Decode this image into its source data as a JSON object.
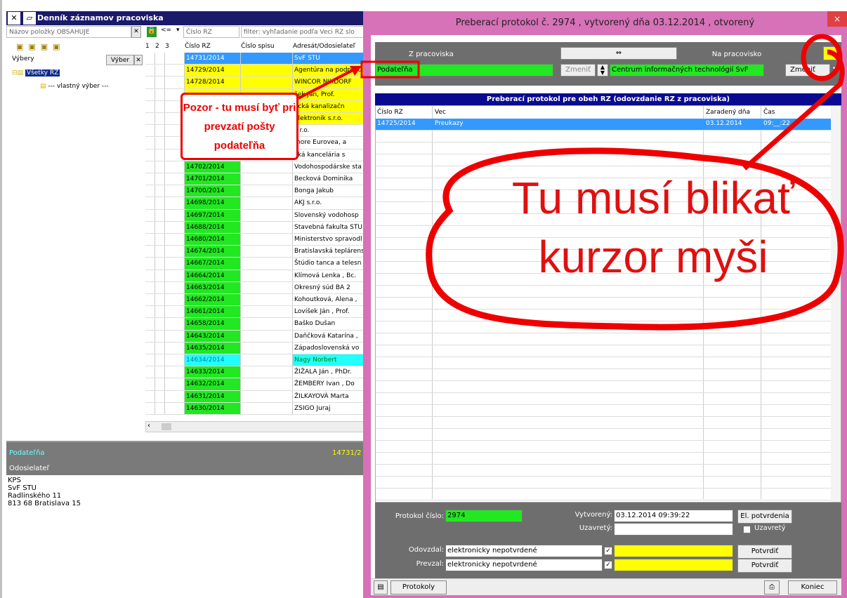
{
  "main": {
    "title": "Denník záznamov pracoviska",
    "filter_label": "Názov položky OBSAHUJE",
    "nav_arrow": "<=",
    "nav_dropdown_value": "Číslo RZ",
    "filter_hint": "filter: vyhľadanie podľa Veci RZ slo",
    "tree_selector_label": "Výbery",
    "tree_selector_button": "Výber",
    "tree_items": [
      "Všetky RZ",
      "--- vlastný výber ---"
    ],
    "grid_headers": [
      "1",
      "2",
      "3",
      "Číslo RZ",
      "Číslo spisu",
      "Adresát/Odosielateľ"
    ],
    "rows": [
      {
        "rz": "14731/2014",
        "who": "SvF STU",
        "style": "selected"
      },
      {
        "rz": "14729/2014",
        "who": "Agentúra na podporu",
        "style": "yellow"
      },
      {
        "rz": "14728/2014",
        "who": "WINCOR NIXDORF",
        "style": "yellow"
      },
      {
        "rz": "",
        "who": "šek Ján, Prof.",
        "style": "yellow"
      },
      {
        "rz": "",
        "who": "ecká kanalizačn",
        "style": "yellow"
      },
      {
        "rz": "",
        "who": "Elektronik s.r.o.",
        "style": "yellow"
      },
      {
        "rz": "",
        "who": "s r.o.",
        "style": "none"
      },
      {
        "rz": "",
        "who": "more Eurovea, a",
        "style": "none"
      },
      {
        "rz": "",
        "who": "cká kancelária s",
        "style": "none"
      },
      {
        "rz": "14702/2014",
        "who": "Vodohospodárske sta",
        "style": "green"
      },
      {
        "rz": "14701/2014",
        "who": "Becková Dominika",
        "style": "green"
      },
      {
        "rz": "14700/2014",
        "who": "Bonga Jakub",
        "style": "green"
      },
      {
        "rz": "14698/2014",
        "who": "AKJ s.r.o.",
        "style": "green"
      },
      {
        "rz": "14697/2014",
        "who": "Slovenský vodohosp",
        "style": "green"
      },
      {
        "rz": "14688/2014",
        "who": "Stavebná fakulta STU",
        "style": "green"
      },
      {
        "rz": "14680/2014",
        "who": "Ministerstvo spravodl",
        "style": "green"
      },
      {
        "rz": "14674/2014",
        "who": "Bratislavská teplárens",
        "style": "green"
      },
      {
        "rz": "14667/2014",
        "who": "Štúdio tanca a telesn",
        "style": "green"
      },
      {
        "rz": "14664/2014",
        "who": "Klímová Lenka , Bc.",
        "style": "green"
      },
      {
        "rz": "14663/2014",
        "who": "Okresný súd BA 2",
        "style": "green"
      },
      {
        "rz": "14662/2014",
        "who": "Kohoutková, Alena ,",
        "style": "green"
      },
      {
        "rz": "14661/2014",
        "who": "Lovíšek Ján , Prof.",
        "style": "green"
      },
      {
        "rz": "14658/2014",
        "who": "Baško Dušan",
        "style": "green"
      },
      {
        "rz": "14643/2014",
        "who": "Daňčková Katarína ,",
        "style": "green"
      },
      {
        "rz": "14635/2014",
        "who": "Západoslovenská vo",
        "style": "green"
      },
      {
        "rz": "14634/2014",
        "who": "Nagy Norbert",
        "style": "cyan"
      },
      {
        "rz": "14633/2014",
        "who": "ŽIŽALA Ján , PhDr.",
        "style": "green"
      },
      {
        "rz": "14632/2014",
        "who": "ŽEMBERY Ivan , Do",
        "style": "green"
      },
      {
        "rz": "14631/2014",
        "who": "ŽILKAYOVÁ Marta",
        "style": "green"
      },
      {
        "rz": "14630/2014",
        "who": "ZSIGO Juraj",
        "style": "green"
      }
    ],
    "bottom": {
      "podatelna": "Podateľňa",
      "rz": "14731/2",
      "odosielatel_label": "Odosielateľ",
      "address": [
        "KPS",
        "SvF STU",
        "Radlinského 11",
        "813 68  Bratislava 15"
      ]
    }
  },
  "dialog": {
    "title": "Preberací protokol č. 2974 , vytvorený dňa 03.12.2014 , otvorený",
    "close": "×",
    "from_label": "Z pracoviska",
    "swap_symbol": "⇔",
    "to_label": "Na pracovisko",
    "from_value": "Podateľňa",
    "change_label": "Zmeniť",
    "to_value": "Centrum informačných technológií SvF",
    "change_label2": "Zmeniť",
    "section_title": "Preberací protokol pre obeh RZ (odovzdanie RZ z pracoviska)",
    "table_headers": [
      "Číslo RZ",
      "Vec",
      "Zaradený dňa",
      "Čas"
    ],
    "table_rows": [
      {
        "rz": "14725/2014",
        "vec": "Preukazy",
        "datum": "03.12.2014",
        "cas": "09:__:22"
      }
    ],
    "protokol_label": "Protokol číslo:",
    "protokol_value": "2974",
    "vytvoreny_label": "Vytvorený:",
    "vytvoreny_value": "03.12.2014 09:39:22",
    "el_potvrdenia": "El. potvrdenia",
    "uzavrety_label": "Uzavretý:",
    "uzavrety_check": "Uzavretý",
    "odovzdal_label": "Odovzdal:",
    "odovzdal_value": "elektronicky nepotvrdené",
    "prevzal_label": "Prevzal:",
    "prevzal_value": "elektronicky nepotvrdené",
    "potvrdit": "Potvrdiť",
    "protokoly": "Protokoly",
    "koniec": "Koniec"
  },
  "annotations": {
    "callout": "Pozor - tu musí byť pri prevzatí pošty podateľňa",
    "big_line1": "Tu musí blikať",
    "big_line2": "kurzor myši"
  },
  "colors": {
    "green": "#22e822",
    "yellow": "#ffff00",
    "selected": "#3399ff",
    "cyan": "#22ffff",
    "red": "#e01010"
  }
}
